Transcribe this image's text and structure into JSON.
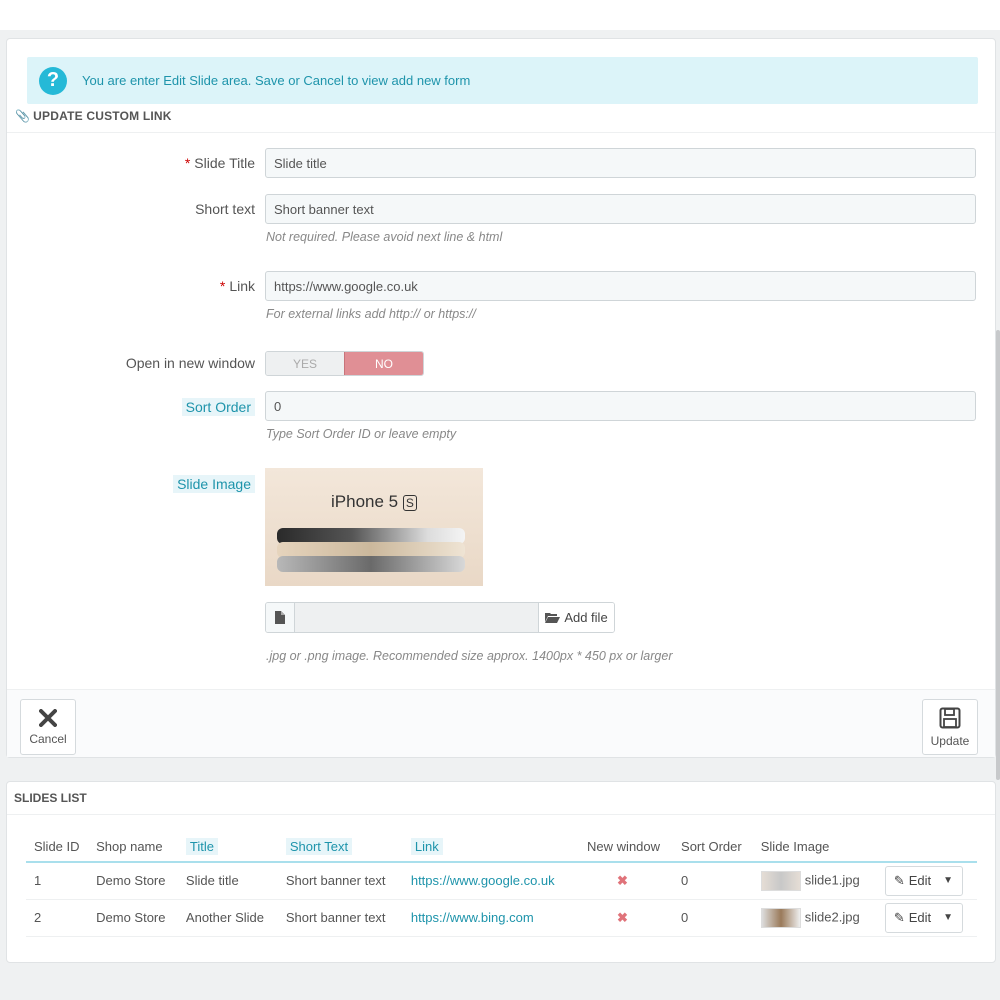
{
  "alert": {
    "text": "You are enter Edit Slide area. Save or Cancel to view add new form"
  },
  "section": {
    "title": "UPDATE CUSTOM LINK"
  },
  "form": {
    "slide_title": {
      "label": "Slide Title",
      "value": "Slide title"
    },
    "short_text": {
      "label": "Short text",
      "value": "Short banner text",
      "help": "Not required. Please avoid next line & html"
    },
    "link": {
      "label": "Link",
      "value": "https://www.google.co.uk",
      "help": "For external links add http:// or https://"
    },
    "new_window": {
      "label": "Open in new window",
      "yes": "YES",
      "no": "NO",
      "selected": "NO"
    },
    "sort_order": {
      "label": "Sort Order",
      "value": "0",
      "help": "Type Sort Order ID or leave empty"
    },
    "slide_image": {
      "label": "Slide Image",
      "preview_text": "iPhone 5",
      "preview_badge": "S",
      "add_file": "Add file",
      "help": ".jpg or .png image. Recommended size approx. 1400px * 450 px or larger"
    }
  },
  "footer": {
    "cancel": "Cancel",
    "update": "Update"
  },
  "list": {
    "title": "SLIDES LIST",
    "columns": [
      "Slide ID",
      "Shop name",
      "Title",
      "Short Text",
      "Link",
      "New window",
      "Sort Order",
      "Slide Image"
    ],
    "rows": [
      {
        "id": "1",
        "shop": "Demo Store",
        "title": "Slide title",
        "short": "Short banner text",
        "link": "https://www.google.co.uk",
        "sort": "0",
        "image": "slide1.jpg",
        "edit": "Edit"
      },
      {
        "id": "2",
        "shop": "Demo Store",
        "title": "Another Slide",
        "short": "Short banner text",
        "link": "https://www.bing.com",
        "sort": "0",
        "image": "slide2.jpg",
        "edit": "Edit"
      }
    ]
  },
  "colors": {
    "accent": "#25b9d7",
    "toggle_no": "#e08f95",
    "link": "#1e94ab"
  }
}
